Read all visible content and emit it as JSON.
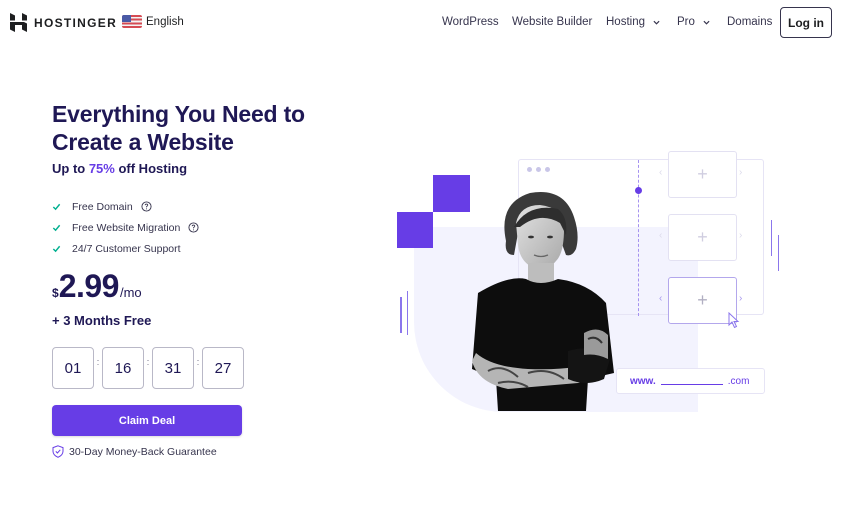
{
  "header": {
    "brand": "HOSTINGER",
    "language": "English",
    "nav": [
      {
        "label": "WordPress",
        "dropdown": false
      },
      {
        "label": "Website Builder",
        "dropdown": false
      },
      {
        "label": "Hosting",
        "dropdown": true
      },
      {
        "label": "Pro",
        "dropdown": true
      },
      {
        "label": "Domains",
        "dropdown": false
      }
    ],
    "login_label": "Log in"
  },
  "hero": {
    "title_line1": "Everything You Need to",
    "title_line2": "Create a Website",
    "subtitle_prefix": "Up to ",
    "subtitle_accent": "75%",
    "subtitle_suffix": " off Hosting",
    "features": [
      {
        "label": "Free Domain",
        "help": true
      },
      {
        "label": "Free Website Migration",
        "help": true
      },
      {
        "label": "24/7 Customer Support",
        "help": false
      }
    ],
    "price": {
      "currency": "$",
      "amount": "2.99",
      "period": "/mo"
    },
    "bonus": "+ 3 Months Free",
    "countdown": [
      "01",
      "16",
      "31",
      "27"
    ],
    "countdown_separator": ":",
    "cta_label": "Claim Deal",
    "guarantee": "30-Day Money-Back Guarantee"
  },
  "illustration": {
    "url_prefix": "www.",
    "url_suffix": ".com",
    "card_symbol": "+",
    "arrow_left": "‹",
    "arrow_right": "›"
  },
  "colors": {
    "accent": "#673de6",
    "heading": "#1f1855",
    "check": "#00b090"
  }
}
